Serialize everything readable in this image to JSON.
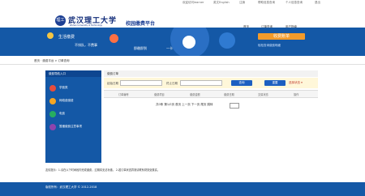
{
  "topbar": {
    "welcome": "欢迎访问learner",
    "lang": "英文English",
    "user": "注销",
    "help": "帮助信息查询",
    "personal": "个人信息查询",
    "exit": "退出"
  },
  "header": {
    "logo_text": "理工",
    "school_name": "武汉理工大学",
    "school_en": "Wuhan University of Technology",
    "site_title": "校园缴费平台",
    "nav": [
      "首页",
      "订单查询",
      "用户指南"
    ]
  },
  "banner": {
    "left_title": "生活缴费",
    "left_sub1": "不排队，不费事",
    "left_sub2": "即缴即到",
    "left_sub3": "一卡",
    "right_title": "收费账单",
    "right_sub": "轻松查询缴费明细"
  },
  "breadcrumb": "首页 · 缴费平台 > 订单查询",
  "sidebar": {
    "title": "缴费导航入口",
    "items": [
      {
        "label": "学费类",
        "color": "#e74c3c"
      },
      {
        "label": "网络费缴费",
        "color": "#f5a623"
      },
      {
        "label": "电费",
        "color": "#27ae60"
      },
      {
        "label": "暂缓缴费注意事项",
        "color": "#8e44ad"
      }
    ]
  },
  "panel": {
    "title": "缴费订单",
    "start_label": "起始日期",
    "end_label": "终止日期",
    "search_btn": "查询",
    "reset_btn": "重置",
    "select_label": "选择状态 ▾",
    "columns": [
      "订单编号",
      "缴费项目",
      "缴费金额",
      "缴费日期",
      "交易状态",
      "操作"
    ],
    "pager": "共0条 第1/0页 首页 上一页 下一页 尾页 跳转"
  },
  "notice": "友情提示：1.请在以下时间段内完成缴费，过期将无法补缴。  2.若订单状态异常请联系财务处核实。",
  "footer": "版权所有：武汉理工大学 © 2012-2018"
}
